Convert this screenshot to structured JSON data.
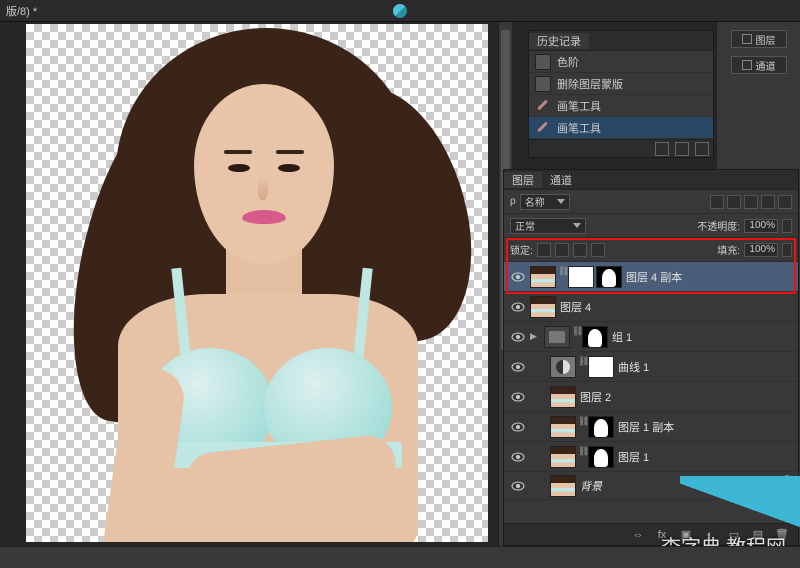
{
  "top_bar": {
    "tab_text": "版/8) *"
  },
  "right_col": {
    "layers_btn": "图层",
    "channels_btn": "通道"
  },
  "history": {
    "panel_title": "历史记录",
    "items": [
      {
        "label": "色阶",
        "icon": "levels"
      },
      {
        "label": "删除图层蒙版",
        "icon": "swatch"
      },
      {
        "label": "画笔工具",
        "icon": "brush"
      },
      {
        "label": "画笔工具",
        "icon": "brush",
        "selected": true
      }
    ]
  },
  "layers_panel": {
    "tabs": {
      "layers": "图层",
      "channels": "通道"
    },
    "filter_kind_label": "类",
    "filter_kind_value": "名称",
    "blend_mode": "正常",
    "opacity_label": "不透明度:",
    "opacity_value": "100%",
    "lock_label": "锁定:",
    "fill_label": "填充:",
    "fill_value": "100%",
    "layers": [
      {
        "name": "图层 4 副本",
        "thumbs": [
          "photo",
          "mask-w",
          "mask-sil"
        ],
        "link": true,
        "selected": true,
        "eye": true
      },
      {
        "name": "图层 4",
        "thumbs": [
          "photo"
        ],
        "eye": true
      },
      {
        "name": "组 1",
        "thumbs": [
          "folder",
          "mask-sil"
        ],
        "link": true,
        "twisty": true,
        "eye": true
      },
      {
        "name": "曲线 1",
        "thumbs": [
          "adj",
          "mask-w"
        ],
        "link": true,
        "indent": 1,
        "eye": true
      },
      {
        "name": "图层 2",
        "thumbs": [
          "photo"
        ],
        "indent": 1,
        "eye": true
      },
      {
        "name": "图层 1 副本",
        "thumbs": [
          "photo",
          "mask-sil"
        ],
        "link": true,
        "indent": 1,
        "eye": true
      },
      {
        "name": "图层 1",
        "thumbs": [
          "photo",
          "mask-sil"
        ],
        "link": true,
        "indent": 1,
        "eye": true
      },
      {
        "name": "背景",
        "thumbs": [
          "bgthumb"
        ],
        "indent": 1,
        "eye": true,
        "locked": true,
        "bg": true
      }
    ]
  },
  "watermark": "查字典  教程网"
}
